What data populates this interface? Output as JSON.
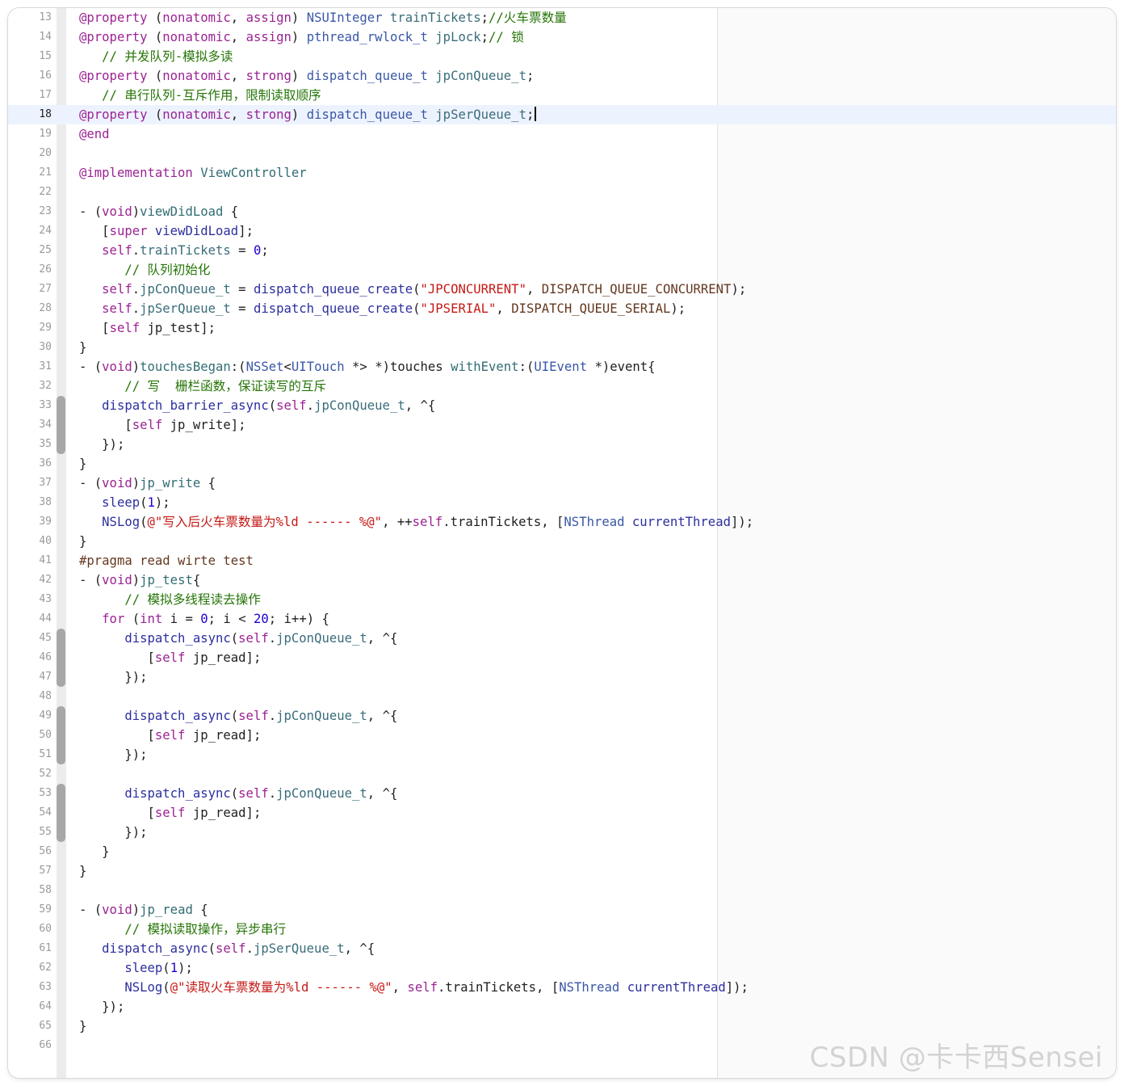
{
  "watermark": "CSDN @卡卡西Sensei",
  "cursor_line": 18,
  "lines": [
    {
      "n": "13",
      "t": [
        [
          "kw",
          "@property"
        ],
        [
          "p",
          " ("
        ],
        [
          "kw",
          "nonatomic"
        ],
        [
          "p",
          ", "
        ],
        [
          "kw",
          "assign"
        ],
        [
          "p",
          ") "
        ],
        [
          "ty",
          "NSUInteger"
        ],
        [
          "p",
          " "
        ],
        [
          "prop",
          "trainTickets"
        ],
        [
          "p",
          ";"
        ],
        [
          "cmt",
          "//火车票数量"
        ]
      ]
    },
    {
      "n": "14",
      "t": [
        [
          "kw",
          "@property"
        ],
        [
          "p",
          " ("
        ],
        [
          "kw",
          "nonatomic"
        ],
        [
          "p",
          ", "
        ],
        [
          "kw",
          "assign"
        ],
        [
          "p",
          ") "
        ],
        [
          "ty",
          "pthread_rwlock_t"
        ],
        [
          "p",
          " "
        ],
        [
          "prop",
          "jpLock"
        ],
        [
          "p",
          ";"
        ],
        [
          "cmt",
          "// 锁"
        ]
      ]
    },
    {
      "n": "15",
      "t": [
        [
          "p",
          "   "
        ],
        [
          "cmt",
          "// 并发队列-模拟多读"
        ]
      ]
    },
    {
      "n": "16",
      "t": [
        [
          "kw",
          "@property"
        ],
        [
          "p",
          " ("
        ],
        [
          "kw",
          "nonatomic"
        ],
        [
          "p",
          ", "
        ],
        [
          "kw",
          "strong"
        ],
        [
          "p",
          ") "
        ],
        [
          "ty",
          "dispatch_queue_t"
        ],
        [
          "p",
          " "
        ],
        [
          "prop",
          "jpConQueue_t"
        ],
        [
          "p",
          ";"
        ]
      ]
    },
    {
      "n": "17",
      "t": [
        [
          "p",
          "   "
        ],
        [
          "cmt",
          "// 串行队列-互斥作用，限制读取顺序"
        ]
      ]
    },
    {
      "n": "18",
      "t": [
        [
          "kw",
          "@property"
        ],
        [
          "p",
          " ("
        ],
        [
          "kw",
          "nonatomic"
        ],
        [
          "p",
          ", "
        ],
        [
          "kw",
          "strong"
        ],
        [
          "p",
          ") "
        ],
        [
          "ty",
          "dispatch_queue_t"
        ],
        [
          "p",
          " "
        ],
        [
          "prop",
          "jpSerQueue_t"
        ],
        [
          "p",
          ";"
        ]
      ]
    },
    {
      "n": "19",
      "t": [
        [
          "kw",
          "@end"
        ]
      ]
    },
    {
      "n": "20",
      "t": []
    },
    {
      "n": "21",
      "t": [
        [
          "kw",
          "@implementation"
        ],
        [
          "p",
          " "
        ],
        [
          "fn",
          "ViewController"
        ]
      ]
    },
    {
      "n": "22",
      "t": []
    },
    {
      "n": "23",
      "t": [
        [
          "p",
          "- ("
        ],
        [
          "kw",
          "void"
        ],
        [
          "p",
          ")"
        ],
        [
          "fn",
          "viewDidLoad"
        ],
        [
          "p",
          " {"
        ]
      ]
    },
    {
      "n": "24",
      "t": [
        [
          "p",
          "   ["
        ],
        [
          "kw",
          "super"
        ],
        [
          "p",
          " "
        ],
        [
          "call",
          "viewDidLoad"
        ],
        [
          "p",
          "];"
        ]
      ]
    },
    {
      "n": "25",
      "t": [
        [
          "p",
          "   "
        ],
        [
          "kw",
          "self"
        ],
        [
          "p",
          "."
        ],
        [
          "prop",
          "trainTickets"
        ],
        [
          "p",
          " = "
        ],
        [
          "num",
          "0"
        ],
        [
          "p",
          ";"
        ]
      ]
    },
    {
      "n": "26",
      "t": [
        [
          "p",
          "      "
        ],
        [
          "cmt",
          "// 队列初始化"
        ]
      ]
    },
    {
      "n": "27",
      "t": [
        [
          "p",
          "   "
        ],
        [
          "kw",
          "self"
        ],
        [
          "p",
          "."
        ],
        [
          "prop",
          "jpConQueue_t"
        ],
        [
          "p",
          " = "
        ],
        [
          "call",
          "dispatch_queue_create"
        ],
        [
          "p",
          "("
        ],
        [
          "str",
          "\"JPCONCURRENT\""
        ],
        [
          "p",
          ", "
        ],
        [
          "mac",
          "DISPATCH_QUEUE_CONCURRENT"
        ],
        [
          "p",
          ");"
        ]
      ]
    },
    {
      "n": "28",
      "t": [
        [
          "p",
          "   "
        ],
        [
          "kw",
          "self"
        ],
        [
          "p",
          "."
        ],
        [
          "prop",
          "jpSerQueue_t"
        ],
        [
          "p",
          " = "
        ],
        [
          "call",
          "dispatch_queue_create"
        ],
        [
          "p",
          "("
        ],
        [
          "str",
          "\"JPSERIAL\""
        ],
        [
          "p",
          ", "
        ],
        [
          "mac",
          "DISPATCH_QUEUE_SERIAL"
        ],
        [
          "p",
          ");"
        ]
      ]
    },
    {
      "n": "29",
      "t": [
        [
          "p",
          "   ["
        ],
        [
          "kw",
          "self"
        ],
        [
          "p",
          " jp_test];"
        ]
      ]
    },
    {
      "n": "30",
      "t": [
        [
          "p",
          "}"
        ]
      ]
    },
    {
      "n": "31",
      "t": [
        [
          "p",
          "- ("
        ],
        [
          "kw",
          "void"
        ],
        [
          "p",
          ")"
        ],
        [
          "fn",
          "touchesBegan"
        ],
        [
          "p",
          ":("
        ],
        [
          "ty",
          "NSSet"
        ],
        [
          "p",
          "<"
        ],
        [
          "ty",
          "UITouch"
        ],
        [
          "p",
          " *> *)touches "
        ],
        [
          "fn",
          "withEvent"
        ],
        [
          "p",
          ":("
        ],
        [
          "ty",
          "UIEvent"
        ],
        [
          "p",
          " *)event{"
        ]
      ]
    },
    {
      "n": "32",
      "t": [
        [
          "p",
          "      "
        ],
        [
          "cmt",
          "// 写  栅栏函数，保证读写的互斥"
        ]
      ]
    },
    {
      "n": "33",
      "t": [
        [
          "p",
          "   "
        ],
        [
          "call",
          "dispatch_barrier_async"
        ],
        [
          "p",
          "("
        ],
        [
          "kw",
          "self"
        ],
        [
          "p",
          "."
        ],
        [
          "prop",
          "jpConQueue_t"
        ],
        [
          "p",
          ", ^{"
        ]
      ]
    },
    {
      "n": "34",
      "t": [
        [
          "p",
          "      ["
        ],
        [
          "kw",
          "self"
        ],
        [
          "p",
          " jp_write];"
        ]
      ]
    },
    {
      "n": "35",
      "t": [
        [
          "p",
          "   });"
        ]
      ]
    },
    {
      "n": "36",
      "t": [
        [
          "p",
          "}"
        ]
      ]
    },
    {
      "n": "37",
      "t": [
        [
          "p",
          "- ("
        ],
        [
          "kw",
          "void"
        ],
        [
          "p",
          ")"
        ],
        [
          "fn",
          "jp_write"
        ],
        [
          "p",
          " {"
        ]
      ]
    },
    {
      "n": "38",
      "t": [
        [
          "p",
          "   "
        ],
        [
          "call",
          "sleep"
        ],
        [
          "p",
          "("
        ],
        [
          "num",
          "1"
        ],
        [
          "p",
          ");"
        ]
      ]
    },
    {
      "n": "39",
      "t": [
        [
          "p",
          "   "
        ],
        [
          "call",
          "NSLog"
        ],
        [
          "p",
          "("
        ],
        [
          "str",
          "@\"写入后火车票数量为%ld ------ %@\""
        ],
        [
          "p",
          ", ++"
        ],
        [
          "kw",
          "self"
        ],
        [
          "p",
          ".trainTickets, ["
        ],
        [
          "ty",
          "NSThread"
        ],
        [
          "p",
          " "
        ],
        [
          "call",
          "currentThread"
        ],
        [
          "p",
          "]);"
        ]
      ]
    },
    {
      "n": "40",
      "t": [
        [
          "p",
          "}"
        ]
      ]
    },
    {
      "n": "41",
      "t": [
        [
          "pre",
          "#pragma read wirte test"
        ]
      ]
    },
    {
      "n": "42",
      "t": [
        [
          "p",
          "- ("
        ],
        [
          "kw",
          "void"
        ],
        [
          "p",
          ")"
        ],
        [
          "fn",
          "jp_test"
        ],
        [
          "p",
          "{"
        ]
      ]
    },
    {
      "n": "43",
      "t": [
        [
          "p",
          "      "
        ],
        [
          "cmt",
          "// 模拟多线程读去操作"
        ]
      ]
    },
    {
      "n": "44",
      "t": [
        [
          "p",
          "   "
        ],
        [
          "kw",
          "for"
        ],
        [
          "p",
          " ("
        ],
        [
          "kw",
          "int"
        ],
        [
          "p",
          " i = "
        ],
        [
          "num",
          "0"
        ],
        [
          "p",
          "; i < "
        ],
        [
          "num",
          "20"
        ],
        [
          "p",
          "; i++) {"
        ]
      ]
    },
    {
      "n": "45",
      "t": [
        [
          "p",
          "      "
        ],
        [
          "call",
          "dispatch_async"
        ],
        [
          "p",
          "("
        ],
        [
          "kw",
          "self"
        ],
        [
          "p",
          "."
        ],
        [
          "prop",
          "jpConQueue_t"
        ],
        [
          "p",
          ", ^{"
        ]
      ]
    },
    {
      "n": "46",
      "t": [
        [
          "p",
          "         ["
        ],
        [
          "kw",
          "self"
        ],
        [
          "p",
          " jp_read];"
        ]
      ]
    },
    {
      "n": "47",
      "t": [
        [
          "p",
          "      });"
        ]
      ]
    },
    {
      "n": "48",
      "t": []
    },
    {
      "n": "49",
      "t": [
        [
          "p",
          "      "
        ],
        [
          "call",
          "dispatch_async"
        ],
        [
          "p",
          "("
        ],
        [
          "kw",
          "self"
        ],
        [
          "p",
          "."
        ],
        [
          "prop",
          "jpConQueue_t"
        ],
        [
          "p",
          ", ^{"
        ]
      ]
    },
    {
      "n": "50",
      "t": [
        [
          "p",
          "         ["
        ],
        [
          "kw",
          "self"
        ],
        [
          "p",
          " jp_read];"
        ]
      ]
    },
    {
      "n": "51",
      "t": [
        [
          "p",
          "      });"
        ]
      ]
    },
    {
      "n": "52",
      "t": []
    },
    {
      "n": "53",
      "t": [
        [
          "p",
          "      "
        ],
        [
          "call",
          "dispatch_async"
        ],
        [
          "p",
          "("
        ],
        [
          "kw",
          "self"
        ],
        [
          "p",
          "."
        ],
        [
          "prop",
          "jpConQueue_t"
        ],
        [
          "p",
          ", ^{"
        ]
      ]
    },
    {
      "n": "54",
      "t": [
        [
          "p",
          "         ["
        ],
        [
          "kw",
          "self"
        ],
        [
          "p",
          " jp_read];"
        ]
      ]
    },
    {
      "n": "55",
      "t": [
        [
          "p",
          "      });"
        ]
      ]
    },
    {
      "n": "56",
      "t": [
        [
          "p",
          "   }"
        ]
      ]
    },
    {
      "n": "57",
      "t": [
        [
          "p",
          "}"
        ]
      ]
    },
    {
      "n": "58",
      "t": []
    },
    {
      "n": "59",
      "t": [
        [
          "p",
          "- ("
        ],
        [
          "kw",
          "void"
        ],
        [
          "p",
          ")"
        ],
        [
          "fn",
          "jp_read"
        ],
        [
          "p",
          " {"
        ]
      ]
    },
    {
      "n": "60",
      "t": [
        [
          "p",
          "      "
        ],
        [
          "cmt",
          "// 模拟读取操作，异步串行"
        ]
      ]
    },
    {
      "n": "61",
      "t": [
        [
          "p",
          "   "
        ],
        [
          "call",
          "dispatch_async"
        ],
        [
          "p",
          "("
        ],
        [
          "kw",
          "self"
        ],
        [
          "p",
          "."
        ],
        [
          "prop",
          "jpSerQueue_t"
        ],
        [
          "p",
          ", ^{"
        ]
      ]
    },
    {
      "n": "62",
      "t": [
        [
          "p",
          "      "
        ],
        [
          "call",
          "sleep"
        ],
        [
          "p",
          "("
        ],
        [
          "num",
          "1"
        ],
        [
          "p",
          ");"
        ]
      ]
    },
    {
      "n": "63",
      "t": [
        [
          "p",
          "      "
        ],
        [
          "call",
          "NSLog"
        ],
        [
          "p",
          "("
        ],
        [
          "str",
          "@\"读取火车票数量为%ld ------ %@\""
        ],
        [
          "p",
          ", "
        ],
        [
          "kw",
          "self"
        ],
        [
          "p",
          ".trainTickets, ["
        ],
        [
          "ty",
          "NSThread"
        ],
        [
          "p",
          " "
        ],
        [
          "call",
          "currentThread"
        ],
        [
          "p",
          "]);"
        ]
      ]
    },
    {
      "n": "64",
      "t": [
        [
          "p",
          "   });"
        ]
      ]
    },
    {
      "n": "65",
      "t": [
        [
          "p",
          "}"
        ]
      ]
    },
    {
      "n": "66",
      "t": []
    }
  ],
  "change_marks": [
    [
      33,
      35
    ],
    [
      45,
      47
    ],
    [
      49,
      51
    ],
    [
      53,
      55
    ]
  ]
}
